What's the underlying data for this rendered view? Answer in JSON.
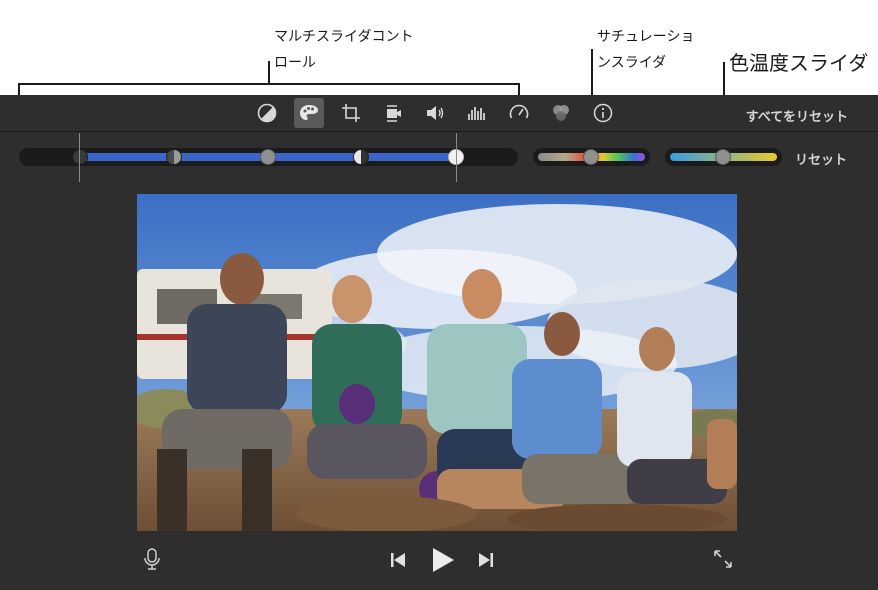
{
  "callouts": {
    "multi_slider_line1": "マルチスライダコント",
    "multi_slider_line2": "ロール",
    "saturation_line1": "サチュレーショ",
    "saturation_line2": "ンスライダ",
    "temperature": "色温度スライダ"
  },
  "toolbar": {
    "tools": [
      {
        "name": "color-balance",
        "icon": "half-circle-icon",
        "active": false
      },
      {
        "name": "color-correction",
        "icon": "palette-icon",
        "active": true
      },
      {
        "name": "crop",
        "icon": "crop-icon",
        "active": false
      },
      {
        "name": "stabilization",
        "icon": "camera-shake-icon",
        "active": false
      },
      {
        "name": "volume",
        "icon": "speaker-icon",
        "active": false
      },
      {
        "name": "noise-reduction",
        "icon": "equalizer-icon",
        "active": false
      },
      {
        "name": "speed",
        "icon": "speedometer-icon",
        "active": false
      },
      {
        "name": "clip-filter",
        "icon": "overlapping-circles-icon",
        "active": false
      },
      {
        "name": "clip-info",
        "icon": "info-icon",
        "active": false
      }
    ],
    "reset_all_label": "すべてをリセット"
  },
  "sliders": {
    "multi": {
      "black": 0.0,
      "shadows": 0.25,
      "midtones": 0.5,
      "highlights": 0.75,
      "white": 1.0
    },
    "saturation": {
      "value": 0.5
    },
    "temperature": {
      "value": 0.5
    },
    "reset_label": "リセット"
  },
  "playback": {
    "mic_icon": "microphone-icon",
    "prev_icon": "skip-back-icon",
    "play_icon": "play-icon",
    "next_icon": "skip-forward-icon",
    "fullscreen_icon": "expand-arrows-icon"
  },
  "colors": {
    "panel": "#2e2e2e",
    "multi_fill": "#3a66c9",
    "temperature_start": "#3a9de0",
    "temperature_end": "#e6c92e"
  }
}
